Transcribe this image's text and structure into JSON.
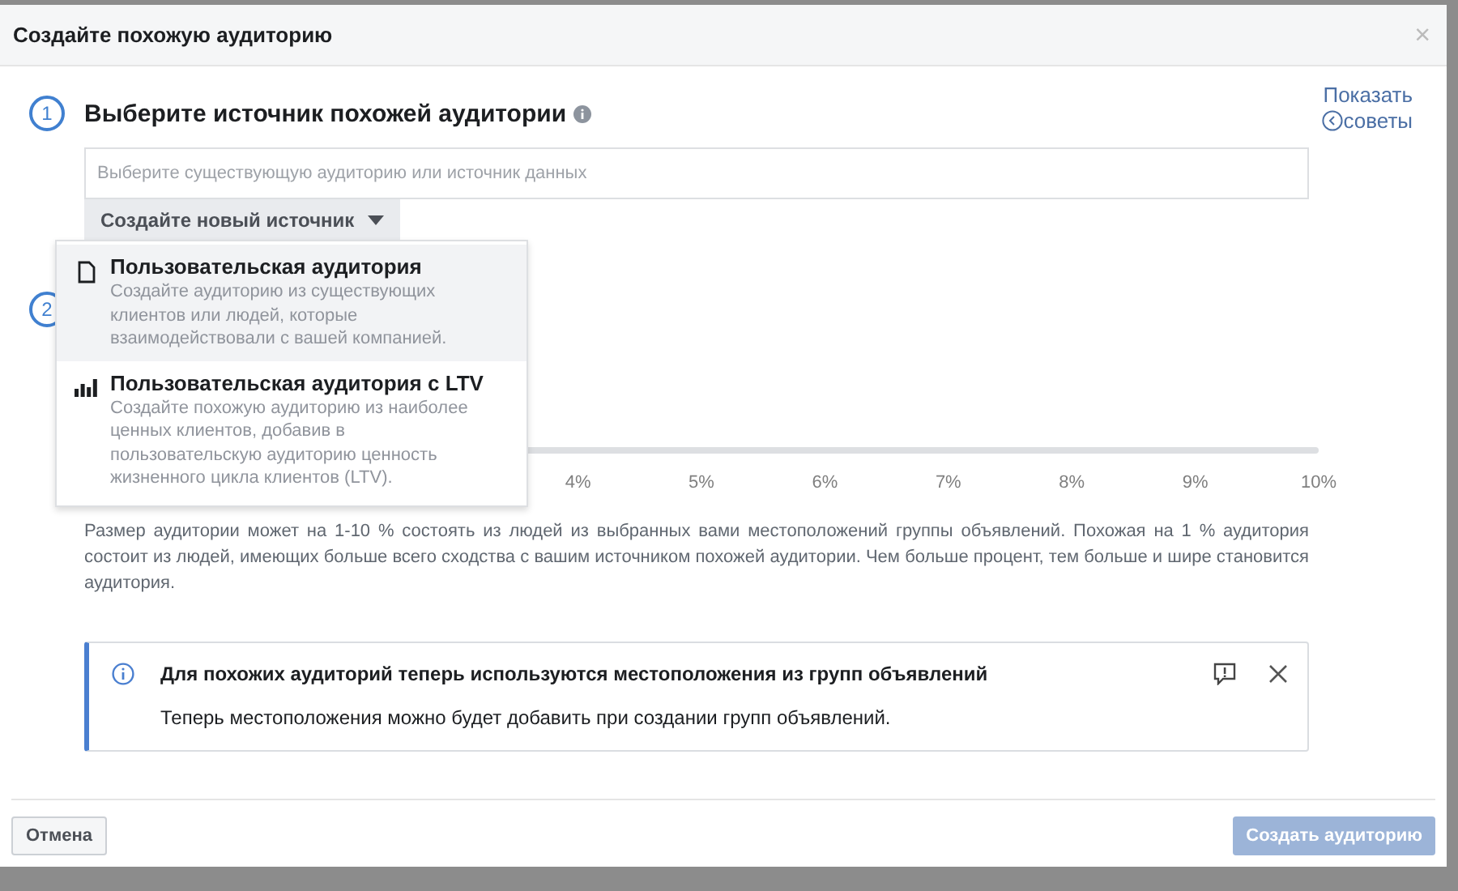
{
  "dialog": {
    "title": "Создайте похожую аудиторию",
    "close": "×"
  },
  "tips_link": {
    "lines": [
      "Показать",
      "советы"
    ]
  },
  "step1": {
    "number": "1",
    "title": "Выберите источник похожей аудитории",
    "source_field": {
      "placeholder": "Выберите существующую аудиторию или источник данных"
    },
    "create_button": "Создайте новый источник"
  },
  "source_menu": [
    {
      "kind": "document",
      "title": "Пользовательская аудитория",
      "description": "Создайте аудиторию из существующих клиентов или людей, которые взаимодействовали с вашей компанией.",
      "selected": true
    },
    {
      "kind": "chart",
      "title": "Пользовательская аудитория с LTV",
      "description": "Создайте похожую аудиторию из наиболее ценных клиентов, добавив в пользовательскую аудиторию ценность жизненного цикла клиентов (LTV).",
      "selected": false
    }
  ],
  "step2": {
    "number": "2",
    "slider": {
      "level": 0,
      "ticks": [
        "4%",
        "5%",
        "6%",
        "7%",
        "8%",
        "9%",
        "10%"
      ]
    },
    "description": "Размер аудитории может на 1-10 % состоять из людей из выбранных вами местоположений группы объявлений. Похожая на 1 % аудитория состоит из людей, имеющих больше всего сходства с вашим источником похожей аудитории. Чем больше процент, тем больше и шире становится аудитория."
  },
  "notice": {
    "title": "Для похожих аудиторий теперь используются местоположения из групп объявлений",
    "body": "Теперь местоположения можно будет добавить при создании групп объявлений."
  },
  "footer": {
    "cancel": "Отмена",
    "create": {
      "label": "Создать аудиторию",
      "disabled": true
    }
  }
}
